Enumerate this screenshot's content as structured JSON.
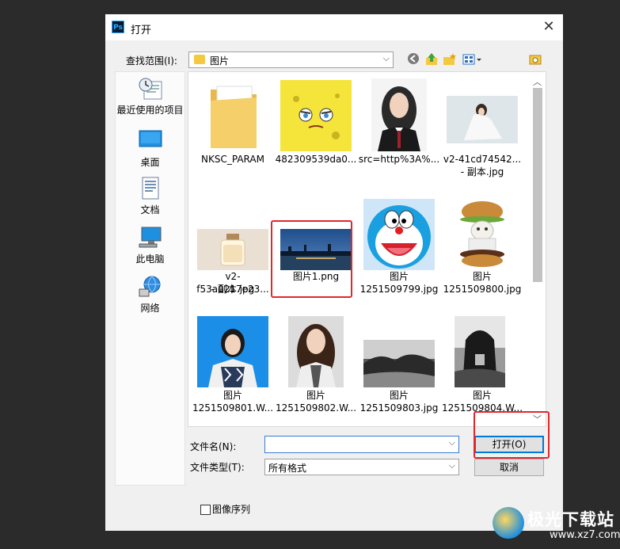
{
  "dialog": {
    "title": "打开",
    "app_icon_text": "Ps",
    "close_symbol": "✕"
  },
  "toolbar": {
    "lookin_label": "查找范围(I):",
    "lookin_value": "图片"
  },
  "places": [
    {
      "label": "最近使用的项目",
      "icon": "recent-icon"
    },
    {
      "label": "桌面",
      "icon": "desktop-icon"
    },
    {
      "label": "文档",
      "icon": "documents-icon"
    },
    {
      "label": "此电脑",
      "icon": "computer-icon"
    },
    {
      "label": "网络",
      "icon": "network-icon"
    }
  ],
  "files": [
    {
      "line1": "NKSC_PARAM",
      "line2": "",
      "kind": "folder"
    },
    {
      "line1": "482309539da0...",
      "line2": "",
      "kind": "spongebob"
    },
    {
      "line1": "src=http%3A%...",
      "line2": "",
      "kind": "portrait-suit"
    },
    {
      "line1": "v2-41cd74542...",
      "line2": "- 副本.jpg",
      "kind": "woman-white"
    },
    {
      "line1": "v2-f53a0217e23...",
      "line2": "- 副本.jpg",
      "kind": "perfume"
    },
    {
      "line1": "图片1.png",
      "line2": "",
      "kind": "night-city"
    },
    {
      "line1": "图片",
      "line2": "1251509799.jpg",
      "kind": "doraemon"
    },
    {
      "line1": "图片",
      "line2": "1251509800.jpg",
      "kind": "burger-cat"
    },
    {
      "line1": "图片",
      "line2": "1251509801.W...",
      "kind": "portrait-blue"
    },
    {
      "line1": "图片",
      "line2": "1251509802.W...",
      "kind": "portrait-long-hair"
    },
    {
      "line1": "图片",
      "line2": "1251509803.jpg",
      "kind": "landscape-bw"
    },
    {
      "line1": "图片",
      "line2": "1251509804.W...",
      "kind": "rock-bw"
    }
  ],
  "form": {
    "filename_label": "文件名(N):",
    "filename_value": "",
    "filetype_label": "文件类型(T):",
    "filetype_value": "所有格式",
    "open_button": "打开(O)",
    "cancel_button": "取消",
    "sequence_label": "图像序列"
  },
  "watermark": {
    "text": "极光下载站",
    "url": "www.xz7.com"
  }
}
